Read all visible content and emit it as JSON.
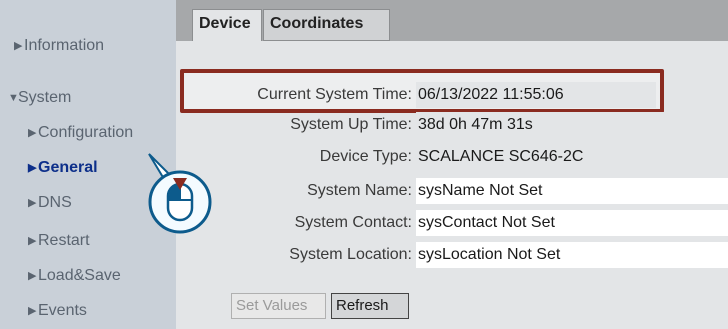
{
  "sidebar": {
    "items": [
      {
        "label": "Information",
        "arrow": "▶"
      },
      {
        "label": "System",
        "arrow": "▼"
      },
      {
        "label": "Configuration",
        "arrow": "▶"
      },
      {
        "label": "General",
        "arrow": "▶"
      },
      {
        "label": "DNS",
        "arrow": "▶"
      },
      {
        "label": "Restart",
        "arrow": "▶"
      },
      {
        "label": "Load&Save",
        "arrow": "▶"
      },
      {
        "label": "Events",
        "arrow": "▶"
      }
    ]
  },
  "tabs": [
    {
      "label": "Device"
    },
    {
      "label": "Coordinates"
    }
  ],
  "fields": [
    {
      "label": "Current System Time:",
      "value": "06/13/2022 11:55:06"
    },
    {
      "label": "System Up Time:",
      "value": "38d 0h 47m 31s"
    },
    {
      "label": "Device Type:",
      "value": "SCALANCE SC646-2C"
    },
    {
      "label": "System Name:",
      "value": "sysName Not Set"
    },
    {
      "label": "System Contact:",
      "value": "sysContact Not Set"
    },
    {
      "label": "System Location:",
      "value": "sysLocation Not Set"
    }
  ],
  "buttons": {
    "set_values": "Set Values",
    "refresh": "Refresh"
  },
  "colors": {
    "sidebar_bg": "#c9d0d8",
    "active_nav": "#0d2f8a",
    "highlight_border": "#8a2b20",
    "tabbar_bg": "#a6a8aa"
  },
  "icons": {
    "click_hint": "mouse-click-icon"
  }
}
